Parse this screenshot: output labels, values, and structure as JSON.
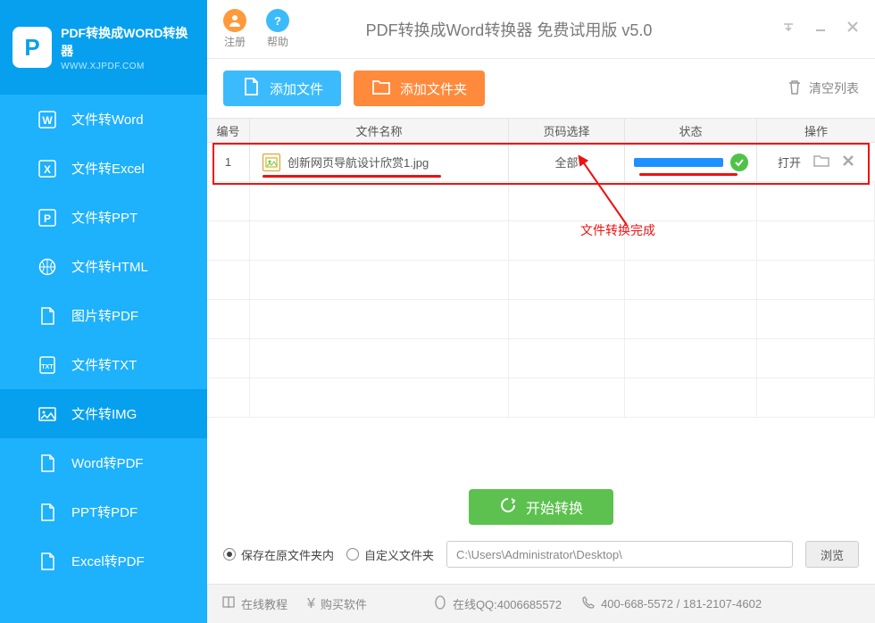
{
  "logo": {
    "letter": "P",
    "title": "PDF转换成WORD转换器",
    "sub": "WWW.XJPDF.COM"
  },
  "sidebar": {
    "items": [
      {
        "label": "文件转Word"
      },
      {
        "label": "文件转Excel"
      },
      {
        "label": "文件转PPT"
      },
      {
        "label": "文件转HTML"
      },
      {
        "label": "图片转PDF"
      },
      {
        "label": "文件转TXT"
      },
      {
        "label": "文件转IMG"
      },
      {
        "label": "Word转PDF"
      },
      {
        "label": "PPT转PDF"
      },
      {
        "label": "Excel转PDF"
      }
    ],
    "active_index": 6
  },
  "titlebar": {
    "register": "注册",
    "help": "帮助",
    "app_title": "PDF转换成Word转换器 免费试用版 v5.0"
  },
  "toolbar": {
    "add_file": "添加文件",
    "add_folder": "添加文件夹",
    "clear_list": "清空列表"
  },
  "table": {
    "headers": {
      "num": "编号",
      "name": "文件名称",
      "page": "页码选择",
      "status": "状态",
      "op": "操作"
    },
    "rows": [
      {
        "num": "1",
        "name": "创新网页导航设计欣赏1.jpg",
        "page": "全部",
        "status_pct": 100,
        "op_open": "打开"
      }
    ]
  },
  "annotation": {
    "text": "文件转换完成"
  },
  "convert": {
    "label": "开始转换"
  },
  "save": {
    "opt1": "保存在原文件夹内",
    "opt2": "自定义文件夹",
    "selected": 0,
    "path": "C:\\Users\\Administrator\\Desktop\\",
    "browse": "浏览"
  },
  "footer": {
    "tutorial": "在线教程",
    "buy": "购买软件",
    "qq_label": "在线QQ:4006685572",
    "phone": "400-668-5572 / 181-2107-4602"
  }
}
